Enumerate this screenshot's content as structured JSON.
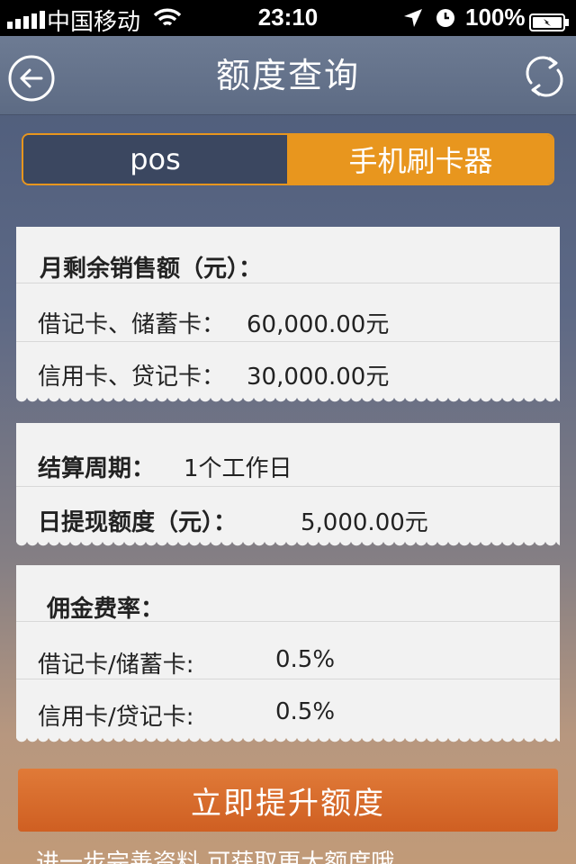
{
  "statusbar": {
    "carrier": "中国移动",
    "time": "23:10",
    "battery_pct": "100%"
  },
  "nav": {
    "title": "额度查询",
    "back_icon": "back-arrow-icon",
    "refresh_icon": "refresh-icon"
  },
  "segment": {
    "options": [
      "pos",
      "手机刷卡器"
    ],
    "selected": "手机刷卡器"
  },
  "sales_card": {
    "heading": "月剩余销售额（元）：",
    "rows": [
      {
        "label": "借记卡、储蓄卡：",
        "value": "60,000.00元"
      },
      {
        "label": "信用卡、贷记卡：",
        "value": "30,000.00元"
      }
    ]
  },
  "settle_card": {
    "cycle_label": "结算周期：",
    "cycle_value": "1个工作日",
    "withdraw_label": "日提现额度（元）：",
    "withdraw_value": "5,000.00元"
  },
  "fee_card": {
    "heading": "佣金费率：",
    "rows": [
      {
        "label": "借记卡/储蓄卡:",
        "value": "0.5%"
      },
      {
        "label": "信用卡/贷记卡:",
        "value": "0.5%"
      }
    ]
  },
  "cta": {
    "label": "立即提升额度"
  },
  "footer": {
    "note": "进一步完善资料,可获取更大额度哦"
  },
  "colors": {
    "accent": "#e8961e",
    "cta": "#d8692c",
    "segment_dark": "#3b4760"
  }
}
